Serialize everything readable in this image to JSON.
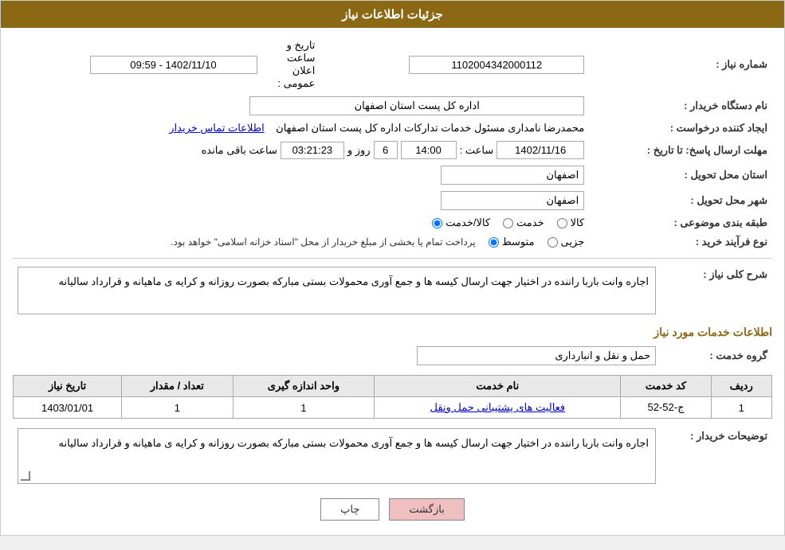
{
  "header": {
    "title": "جزئیات اطلاعات نیاز"
  },
  "fields": {
    "shomare_niaz_label": "شماره نیاز :",
    "shomare_niaz_value": "1102004342000112",
    "nam_dastgah_label": "نام دستگاه خریدار :",
    "nam_dastgah_value": "اداره کل پست استان اصفهان",
    "tarikh_elan_label": "تاریخ و ساعت اعلان عمومی :",
    "tarikh_elan_value": "1402/11/10 - 09:59",
    "ijad_konande_label": "ایجاد کننده درخواست :",
    "ijad_konande_value": "محمدرضا نامداری مسئول خدمات تدارکات اداره کل پست استان اصفهان",
    "ettelaat_tamas_link": "اطلاعات تماس خریدار",
    "mohlat_label": "مهلت ارسال پاسخ: تا تاریخ :",
    "mohlat_date": "1402/11/16",
    "mohlat_saat_label": "ساعت :",
    "mohlat_saat_value": "14:00",
    "mohlat_rooz_label": "روز و",
    "mohlat_rooz_value": "6",
    "countdown_label": "ساعت باقی مانده",
    "countdown_value": "03:21:23",
    "ostan_tahvil_label": "استان محل تحویل :",
    "ostan_tahvil_value": "اصفهان",
    "shahr_tahvil_label": "شهر محل تحویل :",
    "shahr_tahvil_value": "اصفهان",
    "tabaqebandi_label": "طبقه بندی موضوعی :",
    "tabaqebandi_options": [
      "کالا",
      "خدمت",
      "کالا/خدمت"
    ],
    "tabaqebandi_selected": "کالا/خدمت",
    "nooe_farayand_label": "نوع فرآیند خرید :",
    "nooe_farayand_options": [
      "جزیی",
      "متوسط"
    ],
    "nooe_farayand_note": "پرداخت تمام یا بخشی از مبلغ خریدار از محل \"اسناد خزانه اسلامی\" خواهد بود.",
    "sharh_niaz_section": "شرح کلی نیاز :",
    "sharh_niaz_text": "اجاره وانت باربا راننده در اختیار جهت ارسال کیسه ها و جمع آوری محمولات بستی مبارکه بصورت روزانه و کرایه ی ماهیانه و قرارداد سالیانه",
    "services_section": "اطلاعات خدمات مورد نیاز",
    "grooh_khadmat_label": "گروه خدمت :",
    "grooh_khadmat_value": "حمل و نقل و انبارداری",
    "table_headers": [
      "ردیف",
      "کد خدمت",
      "نام خدمت",
      "واحد اندازه گیری",
      "تعداد / مقدار",
      "تاریخ نیاز"
    ],
    "table_rows": [
      {
        "radif": "1",
        "kod_khadmat": "ج-52-52",
        "nam_khadmat": "فعالیت های پشتیبانی حمل ونقل",
        "vahed": "1",
        "tedad": "1",
        "tarikh_niaz": "1403/01/01"
      }
    ],
    "tawzih_label": "توضیحات خریدار :",
    "tawzih_text": "اجاره وانت باربا راننده در اختیار جهت ارسال کیسه ها و جمع آوری محمولات بستی مبارکه بصورت روزانه و کرایه ی ماهیانه و قرارداد سالیانه"
  },
  "buttons": {
    "chap_label": "چاپ",
    "bazgasht_label": "بازگشت"
  },
  "colors": {
    "header_bg": "#8B6914",
    "link_color": "#0000cc",
    "back_btn_bg": "#f0c0c0"
  }
}
